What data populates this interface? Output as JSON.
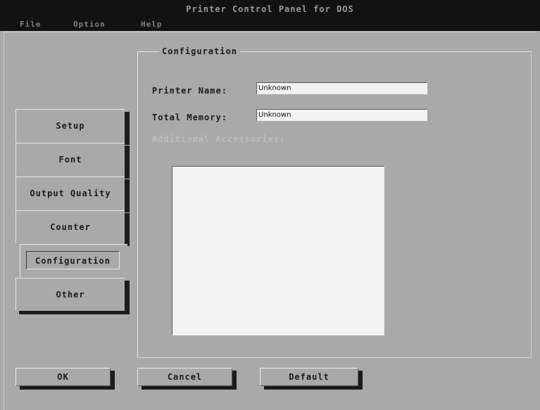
{
  "window": {
    "title": "Printer Control Panel for DOS"
  },
  "menu": {
    "file": "File",
    "option": "Option",
    "help": "Help"
  },
  "tabs": {
    "setup": "Setup",
    "font": "Font",
    "output_quality": "Output Quality",
    "counter": "Counter",
    "configuration": "Configuration",
    "other": "Other",
    "active": "Configuration"
  },
  "panel": {
    "title": "Configuration",
    "printer_name_label": "Printer Name:",
    "printer_name_value": "Unknown",
    "total_memory_label": "Total Memory:",
    "total_memory_value": "Unknown",
    "additional_accessories_label": "Additional Accessories:"
  },
  "buttons": {
    "ok": "OK",
    "cancel": "Cancel",
    "default": "Default"
  },
  "colors": {
    "background": "#a9a9a9",
    "titlebar": "#121212",
    "field": "#f2f2f2"
  }
}
